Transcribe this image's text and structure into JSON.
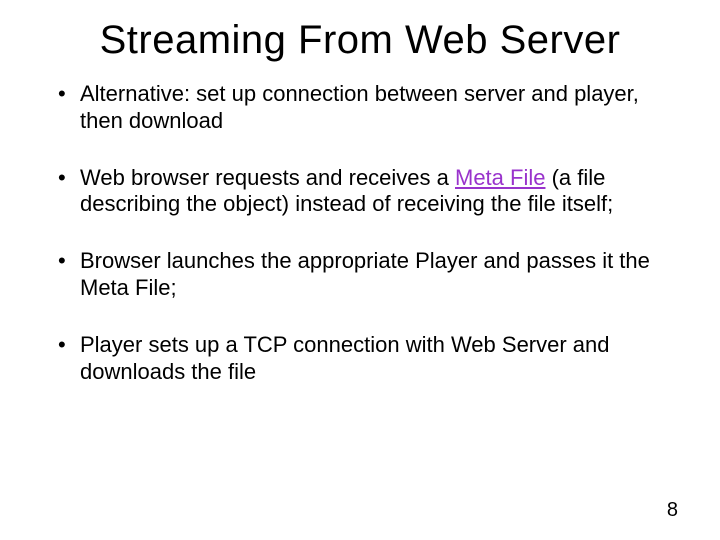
{
  "title": "Streaming From Web Server",
  "bullets": [
    {
      "pre": "Alternative: set up connection between server and player, then download",
      "meta": "",
      "post": ""
    },
    {
      "pre": "Web browser requests and receives a ",
      "meta": "Meta File",
      "post": " (a file describing the object) instead of receiving the file itself;"
    },
    {
      "pre": "Browser launches the appropriate Player and passes it the Meta File;",
      "meta": "",
      "post": ""
    },
    {
      "pre": "Player sets up a TCP connection with Web Server and downloads the file",
      "meta": "",
      "post": ""
    }
  ],
  "page_number": "8"
}
